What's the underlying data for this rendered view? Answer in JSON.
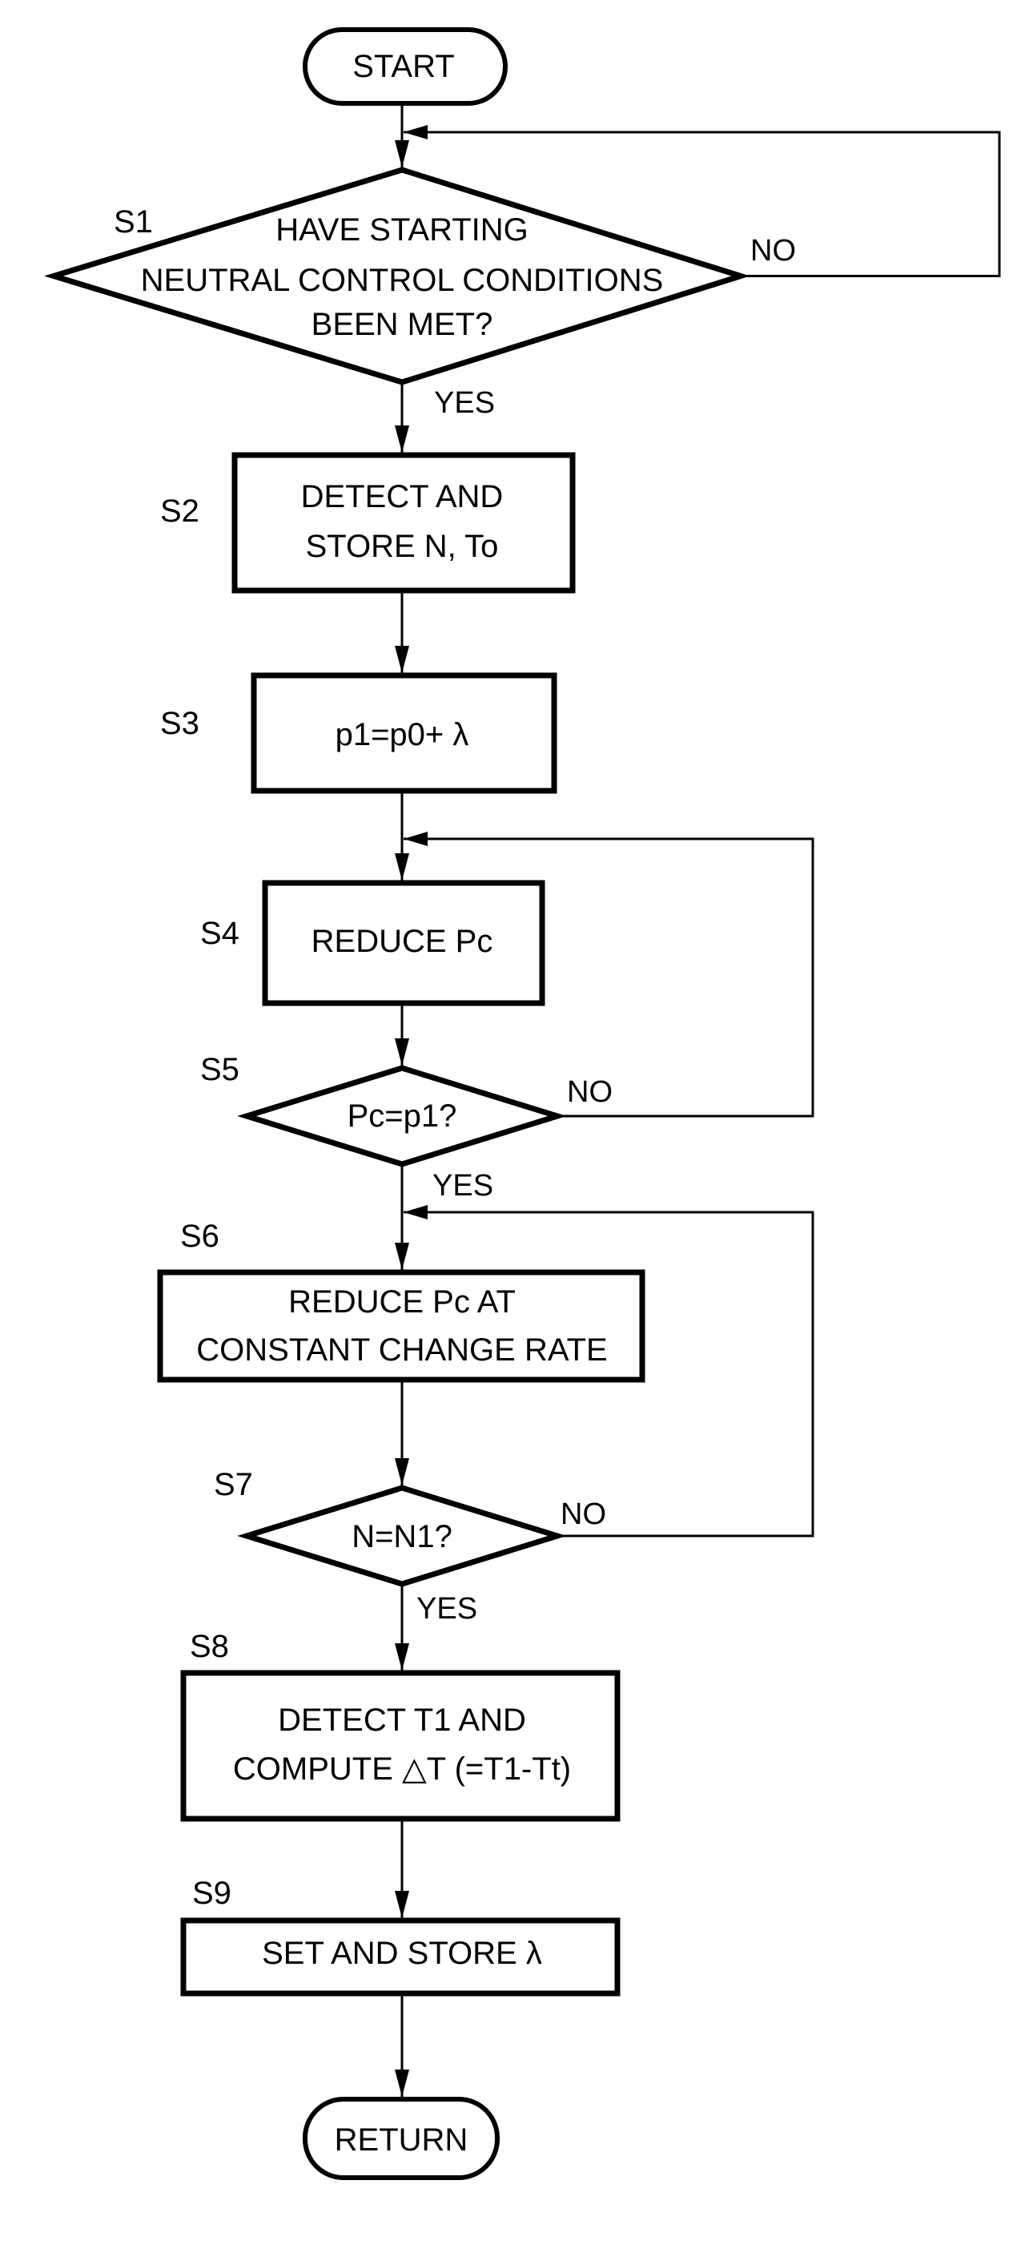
{
  "figure": {
    "type": "flowchart",
    "start": {
      "label": "START"
    },
    "end": {
      "label": "RETURN"
    },
    "steps": [
      {
        "id": "S1",
        "kind": "decision",
        "lines": [
          "HAVE STARTING",
          "NEUTRAL CONTROL CONDITIONS",
          "BEEN MET?"
        ],
        "yes": "YES",
        "no": "NO",
        "no_target": "S1"
      },
      {
        "id": "S2",
        "kind": "process",
        "lines": [
          "DETECT AND",
          "STORE N, To"
        ]
      },
      {
        "id": "S3",
        "kind": "process",
        "lines": [
          "p1=p0+ λ"
        ]
      },
      {
        "id": "S4",
        "kind": "process",
        "lines": [
          "REDUCE Pc"
        ]
      },
      {
        "id": "S5",
        "kind": "decision",
        "lines": [
          "Pc=p1?"
        ],
        "yes": "YES",
        "no": "NO",
        "no_target": "S4"
      },
      {
        "id": "S6",
        "kind": "process",
        "lines": [
          "REDUCE Pc AT",
          "CONSTANT CHANGE RATE"
        ]
      },
      {
        "id": "S7",
        "kind": "decision",
        "lines": [
          "N=N1?"
        ],
        "yes": "YES",
        "no": "NO",
        "no_target": "S6"
      },
      {
        "id": "S8",
        "kind": "process",
        "lines": [
          "DETECT T1 AND",
          "COMPUTE △T (=T1-Tt)"
        ]
      },
      {
        "id": "S9",
        "kind": "process",
        "lines": [
          "SET AND STORE  λ"
        ]
      }
    ]
  }
}
